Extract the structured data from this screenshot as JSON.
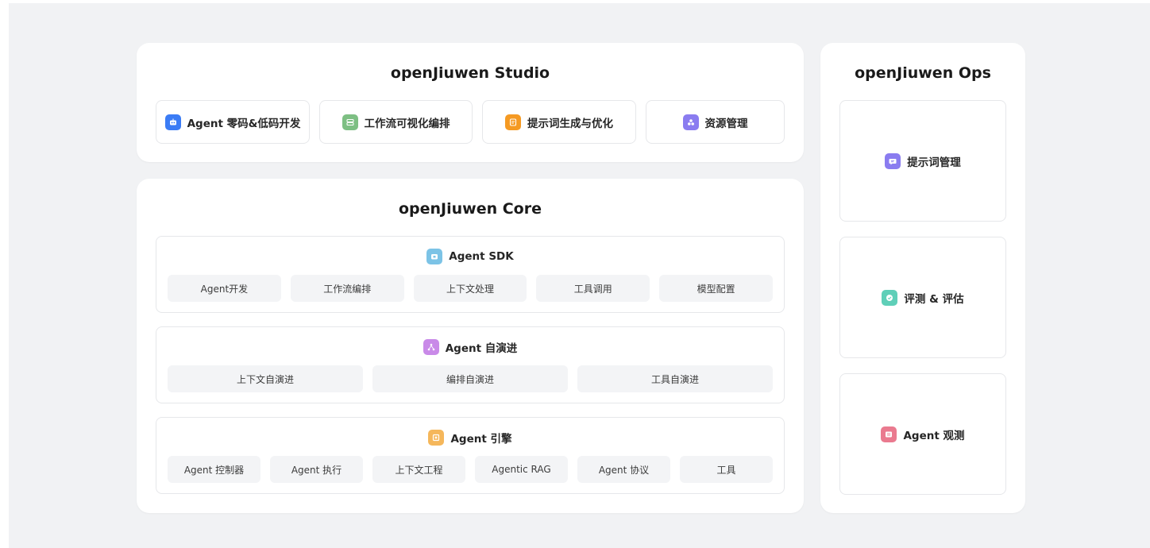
{
  "studio": {
    "title": "openJiuwen Studio",
    "items": [
      {
        "label": "Agent 零码&低码开发",
        "icon": "robot-icon",
        "color": "#3b7cf5"
      },
      {
        "label": "工作流可视化编排",
        "icon": "workflow-icon",
        "color": "#7dbf83"
      },
      {
        "label": "提示词生成与优化",
        "icon": "prompt-icon",
        "color": "#f59a23"
      },
      {
        "label": "资源管理",
        "icon": "resource-icon",
        "color": "#8a7cf0"
      }
    ]
  },
  "core": {
    "title": "openJiuwen Core",
    "sections": [
      {
        "title": "Agent SDK",
        "icon": "sdk-icon",
        "color": "#7cc3e6",
        "items": [
          "Agent开发",
          "工作流编排",
          "上下文处理",
          "工具调用",
          "模型配置"
        ]
      },
      {
        "title": "Agent 自演进",
        "icon": "evolve-icon",
        "color": "#c98ae8",
        "items": [
          "上下文自演进",
          "编排自演进",
          "工具自演进"
        ]
      },
      {
        "title": "Agent 引擎",
        "icon": "engine-icon",
        "color": "#f5b75b",
        "items": [
          "Agent 控制器",
          "Agent 执行",
          "上下文工程",
          "Agentic RAG",
          "Agent 协议",
          "工具"
        ]
      }
    ]
  },
  "ops": {
    "title": "openJiuwen Ops",
    "items": [
      {
        "label": "提示词管理",
        "icon": "prompt-manage-icon",
        "color": "#8a7cf0"
      },
      {
        "label": "评测 & 评估",
        "icon": "evaluate-icon",
        "color": "#5fcfb8"
      },
      {
        "label": "Agent 观测",
        "icon": "observe-icon",
        "color": "#ea7a8f"
      }
    ]
  }
}
